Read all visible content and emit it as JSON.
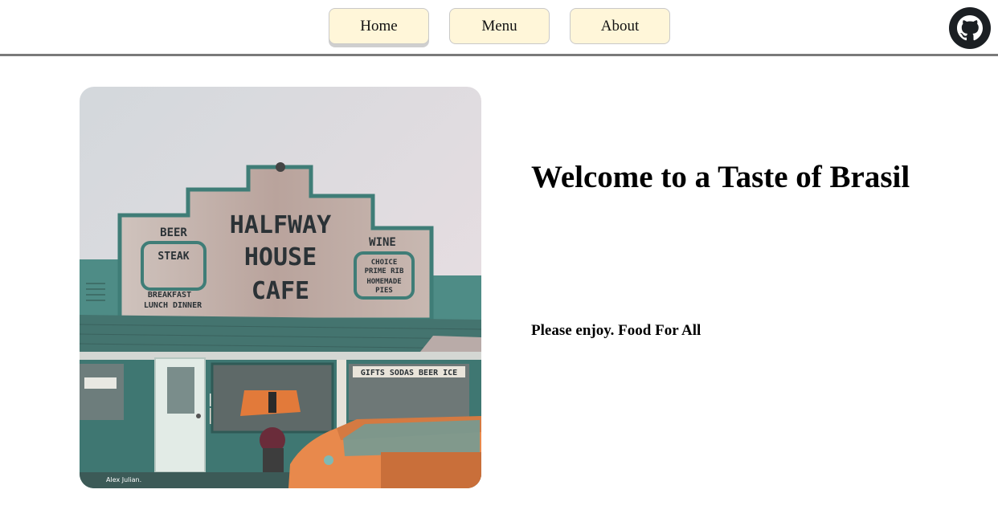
{
  "nav": {
    "items": [
      {
        "label": "Home"
      },
      {
        "label": "Menu"
      },
      {
        "label": "About"
      }
    ]
  },
  "icons": {
    "github": "github-icon"
  },
  "photo": {
    "sign_main": [
      "HALFWAY",
      "HOUSE",
      "CAFE"
    ],
    "sign_left_top": "BEER",
    "sign_left_box": "STEAK",
    "sign_left_bottom": [
      "BREAKFAST",
      "LUNCH DINNER"
    ],
    "sign_right_top": "WINE",
    "sign_right_box": [
      "CHOICE",
      "PRIME RIB",
      "HOMEMADE",
      "PIES"
    ],
    "storefront_sign": "GIFTS SODAS BEER ICE",
    "credit": "Alex Julian."
  },
  "hero": {
    "title": "Welcome to a Taste of Brasil",
    "subtitle": "Please enjoy. Food For All"
  },
  "colors": {
    "nav_button_bg": "#fff6d9",
    "header_rule": "#7a7a7a",
    "teal": "#4e8c86",
    "car_orange": "#e8894c"
  }
}
